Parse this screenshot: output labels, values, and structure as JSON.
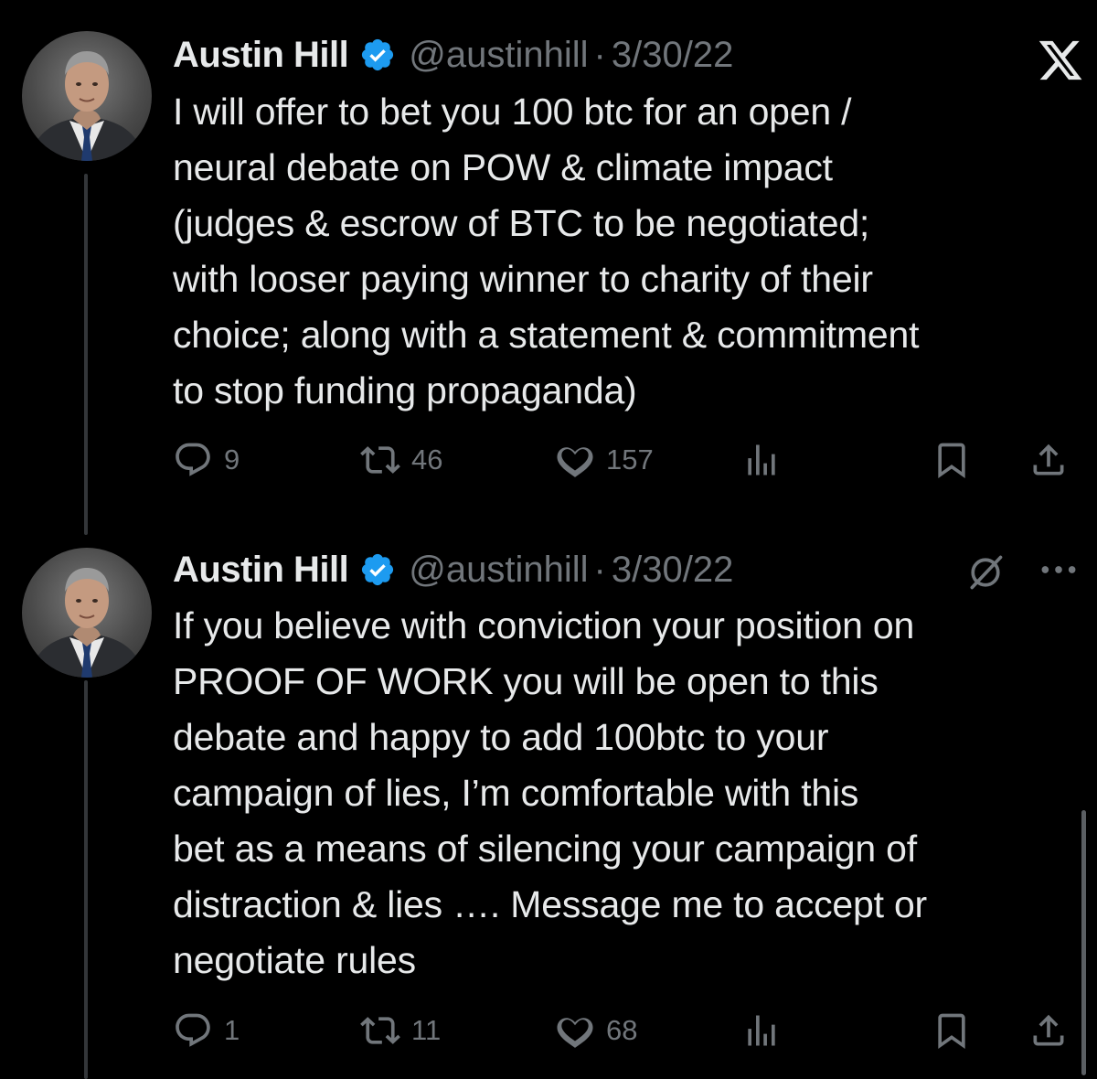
{
  "tweets": [
    {
      "author_name": "Austin Hill",
      "handle": "@austinhill",
      "separator": "·",
      "date": "3/30/22",
      "text": "I will offer to bet you 100 btc for an open /\nneural debate on POW & climate impact\n(judges & escrow of BTC to be negotiated;\nwith looser paying winner to charity of their\nchoice; along with a statement & commitment\nto stop funding propaganda)",
      "replies": "9",
      "reposts": "46",
      "likes": "157"
    },
    {
      "author_name": "Austin Hill",
      "handle": "@austinhill",
      "separator": "·",
      "date": "3/30/22",
      "text": "If you believe with conviction your position on\nPROOF OF WORK you will be open to this\ndebate and happy to add 100btc to your\ncampaign of lies, I’m comfortable with this\nbet as a means of silencing your campaign of\ndistraction & lies …. Message me to accept or\nnegotiate rules",
      "replies": "1",
      "reposts": "11",
      "likes": "68"
    }
  ],
  "icons": {
    "verified": "verified-badge-icon",
    "reply": "reply-icon",
    "repost": "repost-icon",
    "like": "heart-icon",
    "views": "views-icon",
    "bookmark": "bookmark-icon",
    "share": "share-icon",
    "x_logo": "x-logo-icon",
    "grok": "grok-icon",
    "more": "more-icon"
  },
  "colors": {
    "background": "#000000",
    "text": "#e7e9ea",
    "muted": "#71767b",
    "verified": "#1d9bf0"
  }
}
